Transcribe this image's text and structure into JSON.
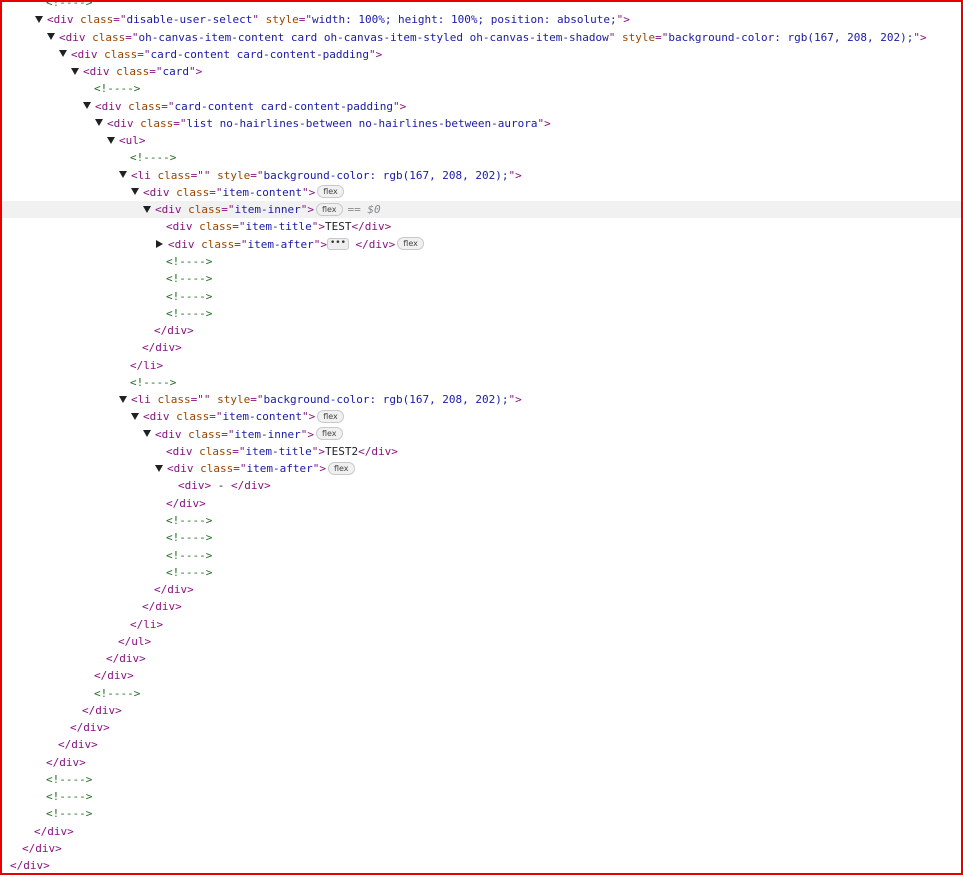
{
  "lines": [
    {
      "indent": 0,
      "twisty": "",
      "kind": "comment",
      "text": "<!---->"
    },
    {
      "indent": 0,
      "twisty": "down",
      "kind": "open",
      "tag": "div",
      "attrs": [
        {
          "n": "class",
          "v": "disable-user-select"
        },
        {
          "n": "style",
          "v": "width: 100%; height: 100%; position: absolute;"
        }
      ]
    },
    {
      "indent": 1,
      "twisty": "down",
      "kind": "open",
      "tag": "div",
      "attrs": [
        {
          "n": "class",
          "v": "oh-canvas-item-content card oh-canvas-item-styled oh-canvas-item-shadow"
        },
        {
          "n": "style",
          "v": "background-color: rgb(167, 208, 202);"
        }
      ]
    },
    {
      "indent": 2,
      "twisty": "down",
      "kind": "open",
      "tag": "div",
      "attrs": [
        {
          "n": "class",
          "v": "card-content card-content-padding"
        }
      ]
    },
    {
      "indent": 3,
      "twisty": "down",
      "kind": "open",
      "tag": "div",
      "attrs": [
        {
          "n": "class",
          "v": "card"
        }
      ]
    },
    {
      "indent": 4,
      "twisty": "",
      "kind": "comment",
      "text": "<!---->"
    },
    {
      "indent": 4,
      "twisty": "down",
      "kind": "open",
      "tag": "div",
      "attrs": [
        {
          "n": "class",
          "v": "card-content card-content-padding"
        }
      ]
    },
    {
      "indent": 5,
      "twisty": "down",
      "kind": "open",
      "tag": "div",
      "attrs": [
        {
          "n": "class",
          "v": "list no-hairlines-between no-hairlines-between-aurora"
        }
      ]
    },
    {
      "indent": 6,
      "twisty": "down",
      "kind": "open",
      "tag": "ul",
      "attrs": []
    },
    {
      "indent": 7,
      "twisty": "",
      "kind": "comment",
      "text": "<!---->"
    },
    {
      "indent": 7,
      "twisty": "down",
      "kind": "open",
      "tag": "li",
      "attrs": [
        {
          "n": "class",
          "v": ""
        },
        {
          "n": "style",
          "v": "background-color: rgb(167, 208, 202);"
        }
      ]
    },
    {
      "indent": 8,
      "twisty": "down",
      "kind": "open",
      "tag": "div",
      "attrs": [
        {
          "n": "class",
          "v": "item-content"
        }
      ],
      "badge": "flex"
    },
    {
      "indent": 9,
      "twisty": "down",
      "kind": "open",
      "tag": "div",
      "attrs": [
        {
          "n": "class",
          "v": "item-inner"
        }
      ],
      "badge": "flex",
      "selected": true,
      "eq": "== $0"
    },
    {
      "indent": 10,
      "twisty": "",
      "kind": "inline",
      "tag": "div",
      "attrs": [
        {
          "n": "class",
          "v": "item-title"
        }
      ],
      "text": "TEST"
    },
    {
      "indent": 10,
      "twisty": "right",
      "kind": "collapsed",
      "tag": "div",
      "attrs": [
        {
          "n": "class",
          "v": "item-after"
        }
      ],
      "ellipsis": "•••",
      "badge": "flex"
    },
    {
      "indent": 10,
      "twisty": "",
      "kind": "comment",
      "text": "<!---->"
    },
    {
      "indent": 10,
      "twisty": "",
      "kind": "comment",
      "text": "<!---->"
    },
    {
      "indent": 10,
      "twisty": "",
      "kind": "comment",
      "text": "<!---->"
    },
    {
      "indent": 10,
      "twisty": "",
      "kind": "comment",
      "text": "<!---->"
    },
    {
      "indent": 9,
      "twisty": "",
      "kind": "close",
      "tag": "div"
    },
    {
      "indent": 8,
      "twisty": "",
      "kind": "close",
      "tag": "div"
    },
    {
      "indent": 7,
      "twisty": "",
      "kind": "close",
      "tag": "li"
    },
    {
      "indent": 7,
      "twisty": "",
      "kind": "comment",
      "text": "<!---->"
    },
    {
      "indent": 7,
      "twisty": "down",
      "kind": "open",
      "tag": "li",
      "attrs": [
        {
          "n": "class",
          "v": ""
        },
        {
          "n": "style",
          "v": "background-color: rgb(167, 208, 202);"
        }
      ]
    },
    {
      "indent": 8,
      "twisty": "down",
      "kind": "open",
      "tag": "div",
      "attrs": [
        {
          "n": "class",
          "v": "item-content"
        }
      ],
      "badge": "flex"
    },
    {
      "indent": 9,
      "twisty": "down",
      "kind": "open",
      "tag": "div",
      "attrs": [
        {
          "n": "class",
          "v": "item-inner"
        }
      ],
      "badge": "flex"
    },
    {
      "indent": 10,
      "twisty": "",
      "kind": "inline",
      "tag": "div",
      "attrs": [
        {
          "n": "class",
          "v": "item-title"
        }
      ],
      "text": "TEST2"
    },
    {
      "indent": 10,
      "twisty": "down",
      "kind": "open",
      "tag": "div",
      "attrs": [
        {
          "n": "class",
          "v": "item-after"
        }
      ],
      "badge": "flex"
    },
    {
      "indent": 11,
      "twisty": "",
      "kind": "inline",
      "tag": "div",
      "attrs": [],
      "text": " - "
    },
    {
      "indent": 10,
      "twisty": "",
      "kind": "close",
      "tag": "div"
    },
    {
      "indent": 10,
      "twisty": "",
      "kind": "comment",
      "text": "<!---->"
    },
    {
      "indent": 10,
      "twisty": "",
      "kind": "comment",
      "text": "<!---->"
    },
    {
      "indent": 10,
      "twisty": "",
      "kind": "comment",
      "text": "<!---->"
    },
    {
      "indent": 10,
      "twisty": "",
      "kind": "comment",
      "text": "<!---->"
    },
    {
      "indent": 9,
      "twisty": "",
      "kind": "close",
      "tag": "div"
    },
    {
      "indent": 8,
      "twisty": "",
      "kind": "close",
      "tag": "div"
    },
    {
      "indent": 7,
      "twisty": "",
      "kind": "close",
      "tag": "li"
    },
    {
      "indent": 6,
      "twisty": "",
      "kind": "close",
      "tag": "ul"
    },
    {
      "indent": 5,
      "twisty": "",
      "kind": "close",
      "tag": "div"
    },
    {
      "indent": 4,
      "twisty": "",
      "kind": "close",
      "tag": "div"
    },
    {
      "indent": 4,
      "twisty": "",
      "kind": "comment",
      "text": "<!---->"
    },
    {
      "indent": 3,
      "twisty": "",
      "kind": "close",
      "tag": "div"
    },
    {
      "indent": 2,
      "twisty": "",
      "kind": "close",
      "tag": "div"
    },
    {
      "indent": 1,
      "twisty": "",
      "kind": "close",
      "tag": "div"
    },
    {
      "indent": 0,
      "twisty": "",
      "kind": "close",
      "tag": "div"
    },
    {
      "indent": 0,
      "twisty": "",
      "kind": "comment",
      "text": "<!---->"
    },
    {
      "indent": 0,
      "twisty": "",
      "kind": "comment",
      "text": "<!---->"
    },
    {
      "indent": 0,
      "twisty": "",
      "kind": "comment",
      "text": "<!---->"
    },
    {
      "indent": -1,
      "twisty": "",
      "kind": "close",
      "tag": "div"
    },
    {
      "indent": -2,
      "twisty": "",
      "kind": "close",
      "tag": "div"
    },
    {
      "indent": -3,
      "twisty": "",
      "kind": "close",
      "tag": "div"
    },
    {
      "indent": -4,
      "twisty": "",
      "kind": "close",
      "tag": "div"
    }
  ]
}
